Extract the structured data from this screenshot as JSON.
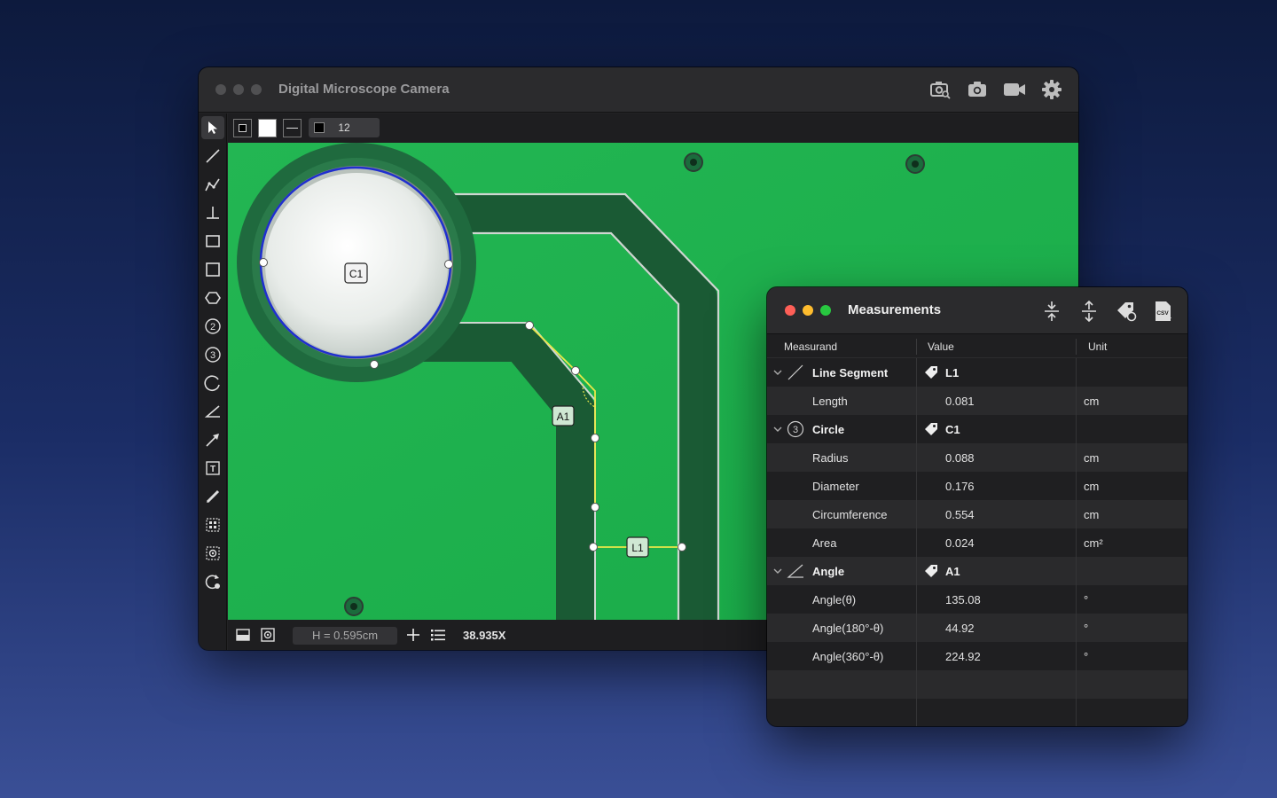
{
  "main_window": {
    "title": "Digital Microscope Camera",
    "line_width": "12",
    "status": {
      "height_readout": "H = 0.595cm",
      "zoom": "38.935X"
    },
    "overlay_labels": {
      "circle": "C1",
      "angle": "A1",
      "line": "L1"
    }
  },
  "measurements_panel": {
    "title": "Measurements",
    "columns": {
      "measurand": "Measurand",
      "value": "Value",
      "unit": "Unit"
    },
    "rows": [
      {
        "kind": "group",
        "name": "Line Segment",
        "tag": "L1",
        "icon": "line-segment-icon"
      },
      {
        "kind": "item",
        "name": "Length",
        "value": "0.081",
        "unit": "cm"
      },
      {
        "kind": "group",
        "name": "Circle",
        "tag": "C1",
        "icon": "circle-3pt-icon"
      },
      {
        "kind": "item",
        "name": "Radius",
        "value": "0.088",
        "unit": "cm"
      },
      {
        "kind": "item",
        "name": "Diameter",
        "value": "0.176",
        "unit": "cm"
      },
      {
        "kind": "item",
        "name": "Circumference",
        "value": "0.554",
        "unit": "cm"
      },
      {
        "kind": "item",
        "name": "Area",
        "value": "0.024",
        "unit": "cm²"
      },
      {
        "kind": "group",
        "name": "Angle",
        "tag": "A1",
        "icon": "angle-icon"
      },
      {
        "kind": "item",
        "name": "Angle(θ)",
        "value": "135.08",
        "unit": "°"
      },
      {
        "kind": "item",
        "name": "Angle(180°-θ)",
        "value": "44.92",
        "unit": "°"
      },
      {
        "kind": "item",
        "name": "Angle(360°-θ)",
        "value": "224.92",
        "unit": "°"
      }
    ]
  },
  "colors": {
    "pcb_green": "#1eb24f",
    "trace_dark": "#1a5a34",
    "measure_blue": "#1f2fcf",
    "measure_yellow": "#e8e84a",
    "close": "#fe5f57",
    "minimize": "#febc2e",
    "zoom": "#28c840"
  }
}
